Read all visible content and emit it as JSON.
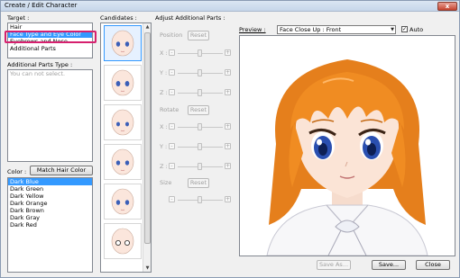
{
  "window": {
    "title": "Create / Edit Character",
    "close_label": "x"
  },
  "target": {
    "label": "Target :",
    "items": [
      "Hair",
      "Face Type and Eye Color",
      "Eyebrows and Nose",
      "Additional Parts"
    ],
    "selected_index": 1
  },
  "additional_parts": {
    "label": "Additional Parts Type :",
    "message": "You can not select."
  },
  "color": {
    "label": "Color :",
    "match_button": "Match Hair Color",
    "items": [
      "Dark Blue",
      "Dark Green",
      "Dark Yellow",
      "Dark Orange",
      "Dark Brown",
      "Dark Gray",
      "Dark Red"
    ],
    "selected_index": 0
  },
  "candidates": {
    "label": "Candidates :",
    "count": 6,
    "selected_index": 0
  },
  "adjust": {
    "label": "Adjust Additional Parts :",
    "position": {
      "label": "Position",
      "reset": "Reset",
      "axes": [
        "X :",
        "Y :",
        "Z :"
      ]
    },
    "rotate": {
      "label": "Rotate",
      "reset": "Reset",
      "axes": [
        "X :",
        "Y :",
        "Z :"
      ]
    },
    "size": {
      "label": "Size",
      "reset": "Reset"
    }
  },
  "preview": {
    "label": "Preview :",
    "view_selected": "Face Close Up : Front",
    "auto_label": "Auto",
    "auto_checked": "✓",
    "hair_color": "#f08c22",
    "eye_color": "#2a4fb0"
  },
  "footer": {
    "save_as": "Save As...",
    "save": "Save...",
    "close": "Close"
  }
}
